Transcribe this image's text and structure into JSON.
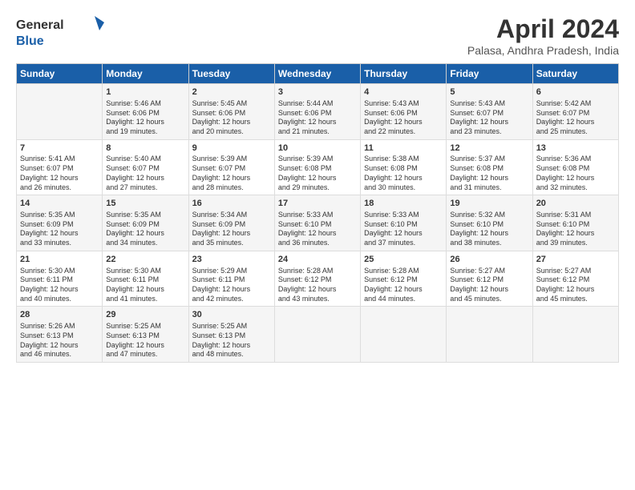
{
  "logo": {
    "line1": "General",
    "line2": "Blue"
  },
  "title": "April 2024",
  "subtitle": "Palasa, Andhra Pradesh, India",
  "days_of_week": [
    "Sunday",
    "Monday",
    "Tuesday",
    "Wednesday",
    "Thursday",
    "Friday",
    "Saturday"
  ],
  "weeks": [
    [
      {
        "day": "",
        "content": ""
      },
      {
        "day": "1",
        "content": "Sunrise: 5:46 AM\nSunset: 6:06 PM\nDaylight: 12 hours\nand 19 minutes."
      },
      {
        "day": "2",
        "content": "Sunrise: 5:45 AM\nSunset: 6:06 PM\nDaylight: 12 hours\nand 20 minutes."
      },
      {
        "day": "3",
        "content": "Sunrise: 5:44 AM\nSunset: 6:06 PM\nDaylight: 12 hours\nand 21 minutes."
      },
      {
        "day": "4",
        "content": "Sunrise: 5:43 AM\nSunset: 6:06 PM\nDaylight: 12 hours\nand 22 minutes."
      },
      {
        "day": "5",
        "content": "Sunrise: 5:43 AM\nSunset: 6:07 PM\nDaylight: 12 hours\nand 23 minutes."
      },
      {
        "day": "6",
        "content": "Sunrise: 5:42 AM\nSunset: 6:07 PM\nDaylight: 12 hours\nand 25 minutes."
      }
    ],
    [
      {
        "day": "7",
        "content": "Sunrise: 5:41 AM\nSunset: 6:07 PM\nDaylight: 12 hours\nand 26 minutes."
      },
      {
        "day": "8",
        "content": "Sunrise: 5:40 AM\nSunset: 6:07 PM\nDaylight: 12 hours\nand 27 minutes."
      },
      {
        "day": "9",
        "content": "Sunrise: 5:39 AM\nSunset: 6:07 PM\nDaylight: 12 hours\nand 28 minutes."
      },
      {
        "day": "10",
        "content": "Sunrise: 5:39 AM\nSunset: 6:08 PM\nDaylight: 12 hours\nand 29 minutes."
      },
      {
        "day": "11",
        "content": "Sunrise: 5:38 AM\nSunset: 6:08 PM\nDaylight: 12 hours\nand 30 minutes."
      },
      {
        "day": "12",
        "content": "Sunrise: 5:37 AM\nSunset: 6:08 PM\nDaylight: 12 hours\nand 31 minutes."
      },
      {
        "day": "13",
        "content": "Sunrise: 5:36 AM\nSunset: 6:08 PM\nDaylight: 12 hours\nand 32 minutes."
      }
    ],
    [
      {
        "day": "14",
        "content": "Sunrise: 5:35 AM\nSunset: 6:09 PM\nDaylight: 12 hours\nand 33 minutes."
      },
      {
        "day": "15",
        "content": "Sunrise: 5:35 AM\nSunset: 6:09 PM\nDaylight: 12 hours\nand 34 minutes."
      },
      {
        "day": "16",
        "content": "Sunrise: 5:34 AM\nSunset: 6:09 PM\nDaylight: 12 hours\nand 35 minutes."
      },
      {
        "day": "17",
        "content": "Sunrise: 5:33 AM\nSunset: 6:10 PM\nDaylight: 12 hours\nand 36 minutes."
      },
      {
        "day": "18",
        "content": "Sunrise: 5:33 AM\nSunset: 6:10 PM\nDaylight: 12 hours\nand 37 minutes."
      },
      {
        "day": "19",
        "content": "Sunrise: 5:32 AM\nSunset: 6:10 PM\nDaylight: 12 hours\nand 38 minutes."
      },
      {
        "day": "20",
        "content": "Sunrise: 5:31 AM\nSunset: 6:10 PM\nDaylight: 12 hours\nand 39 minutes."
      }
    ],
    [
      {
        "day": "21",
        "content": "Sunrise: 5:30 AM\nSunset: 6:11 PM\nDaylight: 12 hours\nand 40 minutes."
      },
      {
        "day": "22",
        "content": "Sunrise: 5:30 AM\nSunset: 6:11 PM\nDaylight: 12 hours\nand 41 minutes."
      },
      {
        "day": "23",
        "content": "Sunrise: 5:29 AM\nSunset: 6:11 PM\nDaylight: 12 hours\nand 42 minutes."
      },
      {
        "day": "24",
        "content": "Sunrise: 5:28 AM\nSunset: 6:12 PM\nDaylight: 12 hours\nand 43 minutes."
      },
      {
        "day": "25",
        "content": "Sunrise: 5:28 AM\nSunset: 6:12 PM\nDaylight: 12 hours\nand 44 minutes."
      },
      {
        "day": "26",
        "content": "Sunrise: 5:27 AM\nSunset: 6:12 PM\nDaylight: 12 hours\nand 45 minutes."
      },
      {
        "day": "27",
        "content": "Sunrise: 5:27 AM\nSunset: 6:12 PM\nDaylight: 12 hours\nand 45 minutes."
      }
    ],
    [
      {
        "day": "28",
        "content": "Sunrise: 5:26 AM\nSunset: 6:13 PM\nDaylight: 12 hours\nand 46 minutes."
      },
      {
        "day": "29",
        "content": "Sunrise: 5:25 AM\nSunset: 6:13 PM\nDaylight: 12 hours\nand 47 minutes."
      },
      {
        "day": "30",
        "content": "Sunrise: 5:25 AM\nSunset: 6:13 PM\nDaylight: 12 hours\nand 48 minutes."
      },
      {
        "day": "",
        "content": ""
      },
      {
        "day": "",
        "content": ""
      },
      {
        "day": "",
        "content": ""
      },
      {
        "day": "",
        "content": ""
      }
    ]
  ]
}
